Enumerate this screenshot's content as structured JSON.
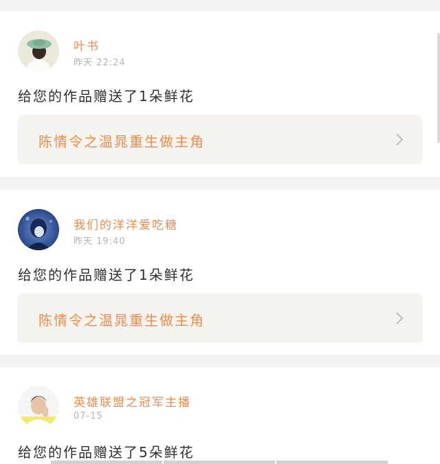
{
  "notifications": [
    {
      "username": "叶书",
      "time": "昨天  22:24",
      "message": "给您的作品赠送了1朵鲜花",
      "work_title": "陈情令之温晁重生做主角",
      "avatar": "avatar-girl-green-hat"
    },
    {
      "username": "我们的洋洋爱吃糖",
      "time": "昨天  19:40",
      "message": "给您的作品赠送了1朵鲜花",
      "work_title": "陈情令之温晁重生做主角",
      "avatar": "avatar-anime-blue"
    },
    {
      "username": "英雄联盟之冠军主播",
      "time": "07-15",
      "message": "给您的作品赠送了5朵鲜花",
      "avatar": "avatar-boy-thinking"
    }
  ],
  "icons": {
    "chevron": "chevron-right-icon"
  },
  "colors": {
    "accent": "#f08b4f",
    "muted": "#b3b3b3",
    "text": "#2f2f2f",
    "link_bg": "#f4f3ee",
    "page_bg": "#f4f3f3"
  }
}
